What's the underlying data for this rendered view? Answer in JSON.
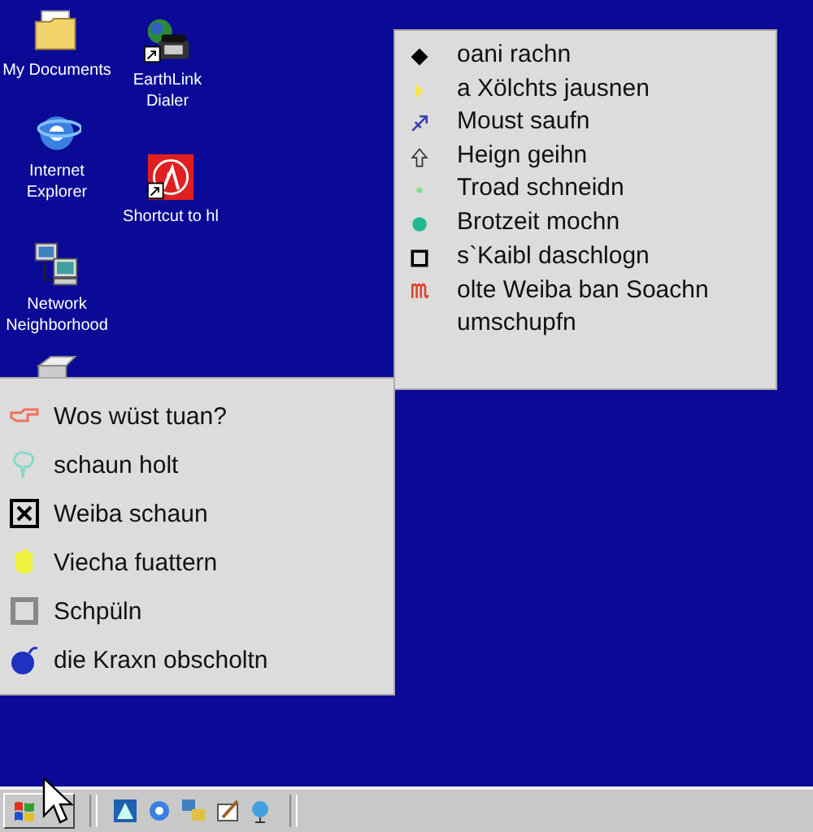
{
  "desktop_icons": [
    {
      "kind": "folder",
      "label": "My Documents"
    },
    {
      "kind": "phone",
      "label": "EarthLink Dialer",
      "shortcut": true
    },
    {
      "kind": "browser",
      "label": "Internet Explorer"
    },
    {
      "kind": "lambda",
      "label": "Shortcut to hl",
      "shortcut": true
    },
    {
      "kind": "network",
      "label": "Network Neighborhood"
    },
    {
      "kind": "drive"
    }
  ],
  "right_menu": {
    "items": [
      {
        "kind": "diamond",
        "color": "#000000",
        "label": "oani rachn"
      },
      {
        "kind": "flag",
        "color": "#f2e64a",
        "label": "a Xölchts jausnen"
      },
      {
        "kind": "archer",
        "color": "#4040b0",
        "label": "Moust saufn"
      },
      {
        "kind": "up-arrow",
        "color": "#333333",
        "label": "Heign geihn"
      },
      {
        "kind": "dot",
        "color": "#7fe08a",
        "label": "Troad schneidn"
      },
      {
        "kind": "circle",
        "color": "#20b890",
        "label": "Brotzeit mochn"
      },
      {
        "kind": "square",
        "color": "#000000",
        "label": "s`Kaibl daschlogn"
      },
      {
        "kind": "virgo",
        "color": "#e04030",
        "label": "olte Weiba ban Soachn umschupfn"
      }
    ]
  },
  "left_menu": {
    "items": [
      {
        "kind": "hand",
        "color": "#f07060",
        "label": "Wos wüst tuan?"
      },
      {
        "kind": "tree",
        "color": "#80d8c8",
        "label": "schaun holt"
      },
      {
        "kind": "x-box",
        "color": "#000000",
        "label": "Weiba schaun"
      },
      {
        "kind": "palm",
        "color": "#f0f040",
        "label": "Viecha fuattern"
      },
      {
        "kind": "square",
        "color": "#888888",
        "label": "Schpüln"
      },
      {
        "kind": "bomb",
        "color": "#2030c0",
        "label": "die Kraxn obscholtn"
      }
    ]
  }
}
